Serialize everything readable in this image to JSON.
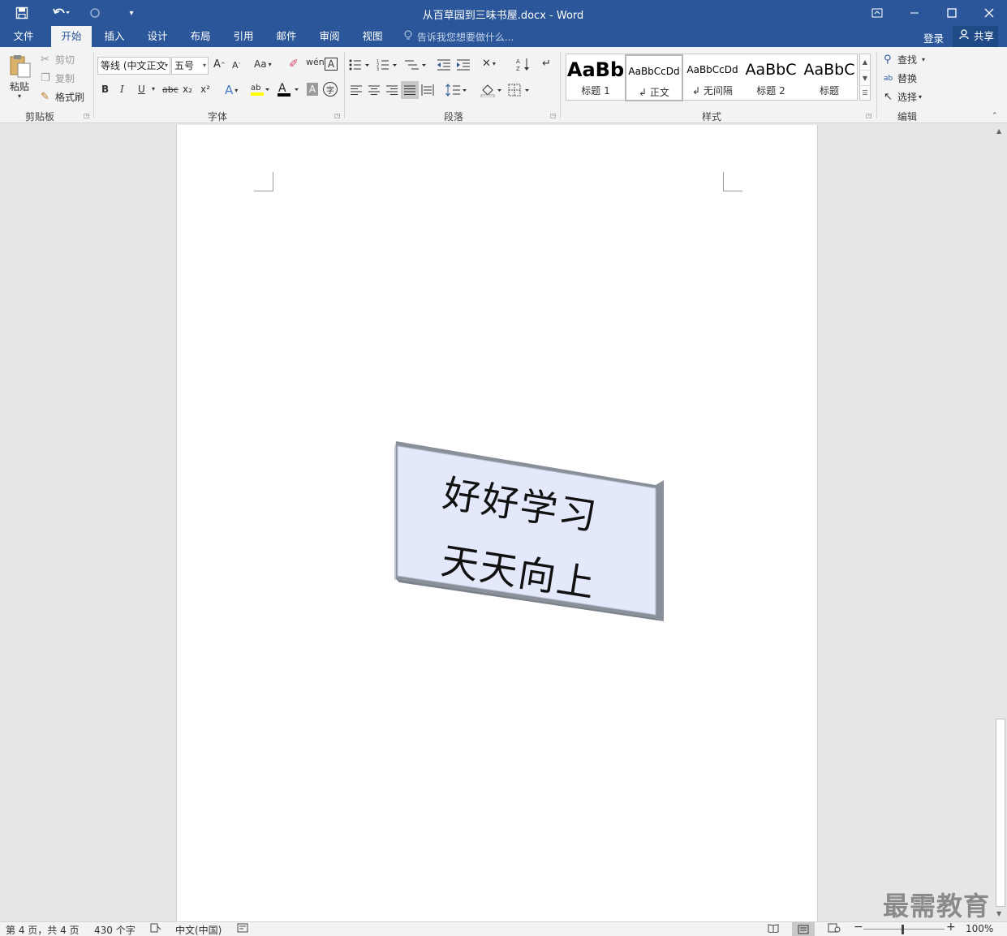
{
  "app": {
    "window_title": "从百草园到三味书屋.docx - Word"
  },
  "quick_access": {
    "save_icon": "save-icon",
    "undo_icon": "undo-icon",
    "redo_icon": "redo-icon",
    "customize_icon": "customize-icon"
  },
  "tabs": [
    {
      "label": "文件"
    },
    {
      "label": "开始"
    },
    {
      "label": "插入"
    },
    {
      "label": "设计"
    },
    {
      "label": "布局"
    },
    {
      "label": "引用"
    },
    {
      "label": "邮件"
    },
    {
      "label": "审阅"
    },
    {
      "label": "视图"
    }
  ],
  "tell_me": "告诉我您想要做什么...",
  "account": {
    "login": "登录",
    "share": "共享"
  },
  "clipboard": {
    "paste": "粘贴",
    "cut": "剪切",
    "copy": "复制",
    "format_painter": "格式刷",
    "group": "剪贴板"
  },
  "font": {
    "font_name": "等线 (中文正文",
    "font_size": "五号",
    "group": "字体",
    "bold": "B",
    "italic": "I",
    "underline": "U",
    "strike": "abc",
    "subscript": "x₂",
    "superscript": "x²",
    "change_case": "Aa",
    "grow": "A",
    "shrink": "A"
  },
  "paragraph": {
    "group": "段落"
  },
  "styles": {
    "group": "样式",
    "items": [
      {
        "sample": "AaBb",
        "name": "标题 1"
      },
      {
        "sample": "AaBbCcDd",
        "name": "正文"
      },
      {
        "sample": "AaBbCcDd",
        "name": "无间隔"
      },
      {
        "sample": "AaBbC",
        "name": "标题 2"
      },
      {
        "sample": "AaBbC",
        "name": "标题"
      }
    ]
  },
  "editing": {
    "find": "查找",
    "replace": "替换",
    "select": "选择",
    "group": "编辑"
  },
  "document": {
    "shape_line1": "好好学习",
    "shape_line2": "天天向上",
    "shape_fill": "#e3e8fb",
    "shape_side": "#8a9099"
  },
  "status": {
    "page": "第 4 页，共 4 页",
    "words": "430 个字",
    "language": "中文(中国)",
    "zoom": "100%"
  },
  "watermark": "最需教育"
}
